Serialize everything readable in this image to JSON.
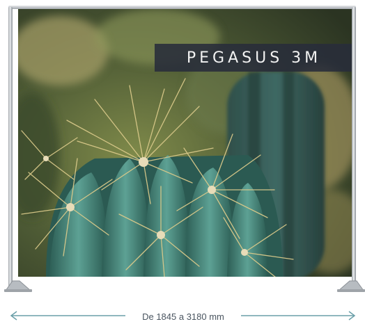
{
  "banner": {
    "brand": "PEGASUS 3M"
  },
  "dimension": {
    "label": "De 1845 a 3180 mm",
    "color": "#6a9fa8"
  },
  "colors": {
    "brand_box": "#282c3a",
    "frame": "#c5c9cd"
  }
}
